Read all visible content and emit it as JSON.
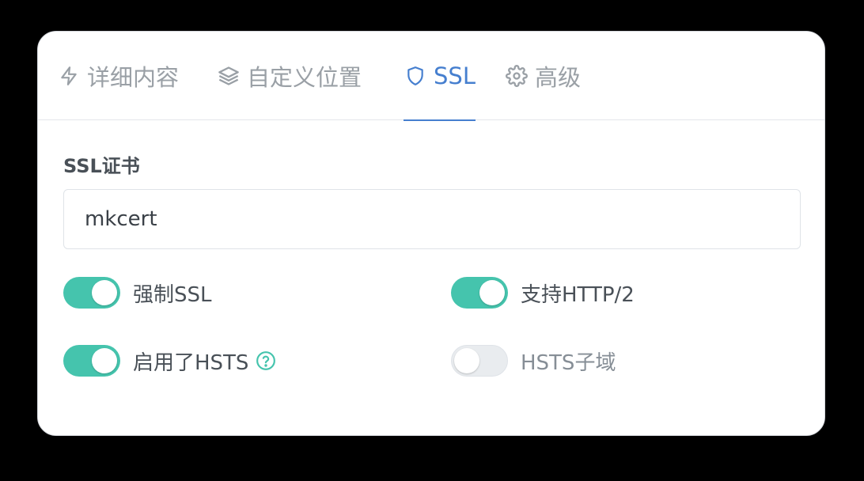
{
  "tabs": [
    {
      "label": "详细内容",
      "icon": "lightning-icon",
      "active": false
    },
    {
      "label": "自定义位置",
      "icon": "layers-icon",
      "active": false
    },
    {
      "label": "SSL",
      "icon": "shield-icon",
      "active": true
    },
    {
      "label": "高级",
      "icon": "gear-icon",
      "active": false
    }
  ],
  "ssl": {
    "certificate_label": "SSL证书",
    "certificate_value": "mkcert",
    "options": [
      {
        "label": "强制SSL",
        "enabled": true
      },
      {
        "label": "支持HTTP/2",
        "enabled": true
      },
      {
        "label": "启用了HSTS",
        "enabled": true,
        "help_icon": "question-circle-icon"
      },
      {
        "label": "HSTS子域",
        "enabled": false
      }
    ]
  },
  "colors": {
    "accent": "#467fcf",
    "toggle_on": "#45c4ad",
    "toggle_off": "#e9ecef",
    "muted_text": "#9aa0a6"
  }
}
